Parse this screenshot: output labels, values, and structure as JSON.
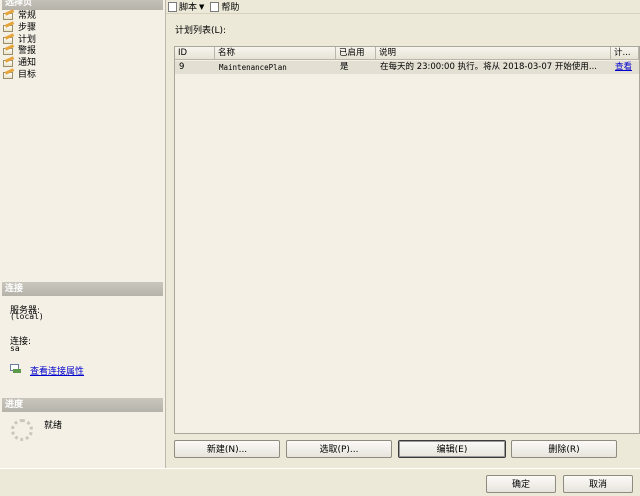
{
  "left_pane": {
    "select_page_header": "选择页",
    "pages": [
      {
        "label": "常规",
        "icon": "page-icon"
      },
      {
        "label": "步骤",
        "icon": "page-icon"
      },
      {
        "label": "计划",
        "icon": "page-icon"
      },
      {
        "label": "警报",
        "icon": "page-icon"
      },
      {
        "label": "通知",
        "icon": "page-icon"
      },
      {
        "label": "目标",
        "icon": "page-icon"
      }
    ],
    "connection_header": "连接",
    "server_label": "服务器:",
    "server_value": "(local)",
    "connection_label": "连接:",
    "connection_value": "sa",
    "view_connection_link": "查看连接属性",
    "progress_header": "进度",
    "progress_status": "就绪"
  },
  "toolbar": {
    "script_label": "脚本",
    "help_label": "帮助"
  },
  "main": {
    "list_label": "计划列表(L):",
    "columns": [
      "ID",
      "名称",
      "已启用",
      "说明",
      "计..."
    ],
    "rows": [
      {
        "id": "9",
        "name": "MaintenancePlan",
        "enabled": "是",
        "description": "在每天的 23:00:00 执行。将从 2018-03-07 开始使用...",
        "action": "查看"
      }
    ],
    "buttons": {
      "new": "新建(N)...",
      "pick": "选取(P)...",
      "edit": "编辑(E)",
      "delete": "删除(R)"
    }
  },
  "footer": {
    "ok": "确定",
    "cancel": "取消"
  },
  "colors": {
    "background": "#ece9d8",
    "pane": "#f4f0e6",
    "link": "#0000cc"
  }
}
